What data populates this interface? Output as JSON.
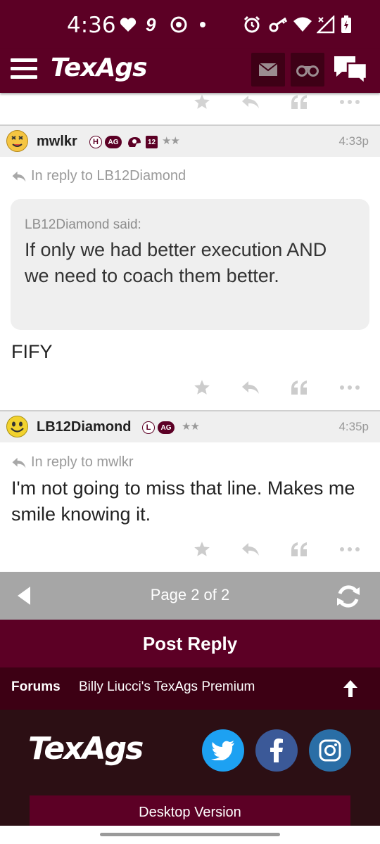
{
  "status_bar": {
    "time": "4:36"
  },
  "app_header": {
    "brand": "TexAgs"
  },
  "posts": [
    {
      "username": "mwlkr",
      "badges": [
        "H",
        "AG",
        "12"
      ],
      "stars": "★★",
      "time": "4:33p",
      "reply_to": "In reply to LB12Diamond",
      "quote_author": "LB12Diamond said:",
      "quote_text": "If only we had better execution AND we need to coach them better.",
      "body": "FIFY"
    },
    {
      "username": "LB12Diamond",
      "badges": [
        "L",
        "AG"
      ],
      "stars": "★★",
      "time": "4:35p",
      "reply_to": "In reply to mwlkr",
      "body": "I'm not going to miss that line. Makes me smile knowing it."
    }
  ],
  "pager": {
    "label": "Page 2 of 2"
  },
  "post_reply": {
    "label": "Post Reply"
  },
  "breadcrumbs": {
    "forums": "Forums",
    "current": "Billy Liucci's TexAgs Premium"
  },
  "footer": {
    "brand": "TexAgs",
    "desktop_version": "Desktop Version"
  },
  "colors": {
    "maroon": "#5c0025",
    "dark_maroon": "#3d0014",
    "footer_bg": "#2c0f14",
    "twitter": "#1da1f2",
    "facebook": "#3b5998",
    "instagram": "#2a6ea6"
  }
}
